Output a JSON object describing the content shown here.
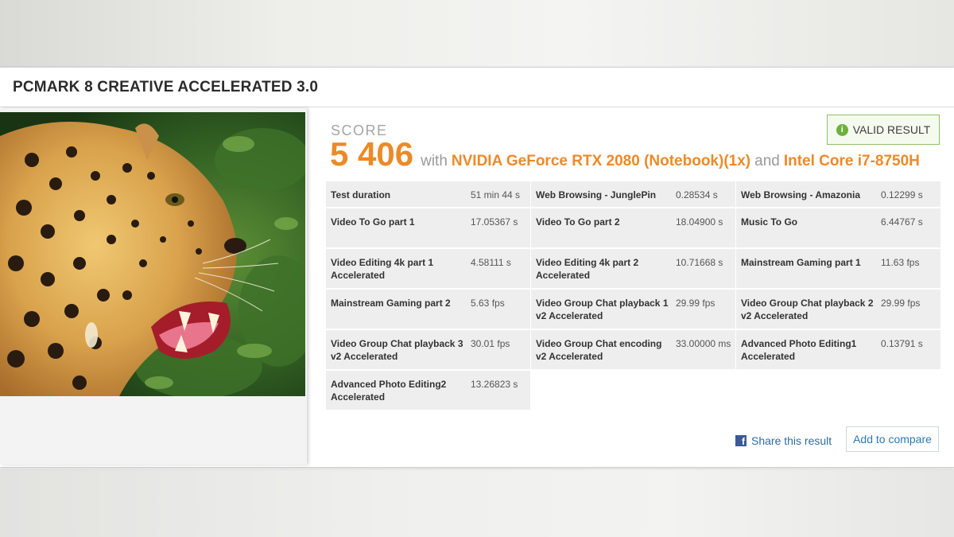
{
  "header": {
    "title": "PCMARK 8 CREATIVE ACCELERATED 3.0"
  },
  "score": {
    "label": "SCORE",
    "value": "5 406",
    "with_text": "with",
    "gpu": "NVIDIA GeForce RTX 2080 (Notebook)(1x)",
    "and_text": "and",
    "cpu": "Intel Core i7-8750H"
  },
  "badge": {
    "label": "VALID RESULT",
    "icon": "info-icon"
  },
  "results": [
    {
      "name": "Test duration",
      "value": "51 min 44 s"
    },
    {
      "name": "Web Browsing - JunglePin",
      "value": "0.28534 s"
    },
    {
      "name": "Web Browsing - Amazonia",
      "value": "0.12299 s"
    },
    {
      "name": "Video To Go part 1",
      "value": "17.05367 s"
    },
    {
      "name": "Video To Go part 2",
      "value": "18.04900 s"
    },
    {
      "name": "Music To Go",
      "value": "6.44767 s"
    },
    {
      "name": "Video Editing 4k part 1 Accelerated",
      "value": "4.58111 s"
    },
    {
      "name": "Video Editing 4k part 2 Accelerated",
      "value": "10.71668 s"
    },
    {
      "name": "Mainstream Gaming part 1",
      "value": "11.63 fps"
    },
    {
      "name": "Mainstream Gaming part 2",
      "value": "5.63 fps"
    },
    {
      "name": "Video Group Chat playback 1 v2 Accelerated",
      "value": "29.99 fps"
    },
    {
      "name": "Video Group Chat playback 2 v2 Accelerated",
      "value": "29.99 fps"
    },
    {
      "name": "Video Group Chat playback 3 v2 Accelerated",
      "value": "30.01 fps"
    },
    {
      "name": "Video Group Chat encoding v2 Accelerated",
      "value": "33.00000 ms"
    },
    {
      "name": "Advanced Photo Editing1 Accelerated",
      "value": "0.13791 s"
    },
    {
      "name": "Advanced Photo Editing2 Accelerated",
      "value": "13.26823 s"
    }
  ],
  "actions": {
    "share_label": "Share this result",
    "compare_label": "Add to compare"
  },
  "colors": {
    "accent": "#ec8a28",
    "valid_border": "#8fc06a",
    "link": "#2a7ab0",
    "facebook": "#3b5998"
  }
}
